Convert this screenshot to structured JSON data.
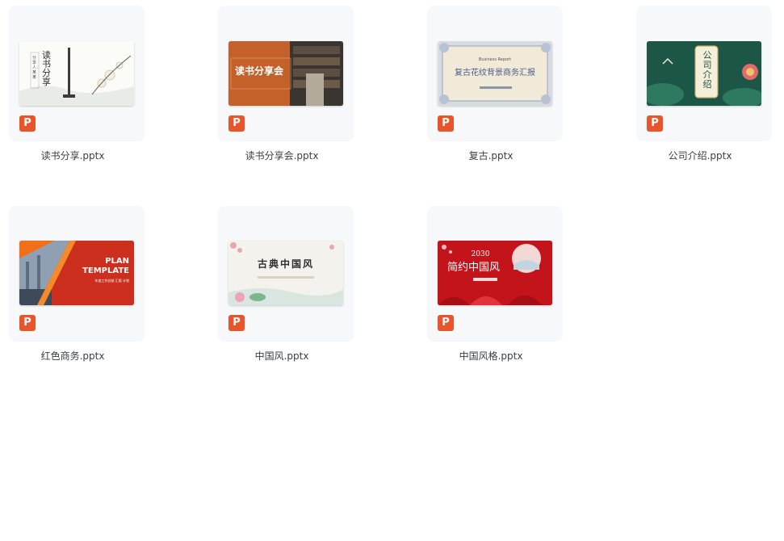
{
  "files": [
    {
      "name": "读书分享.pptx",
      "thumb_text": "读书分享",
      "thumb_small": "分享人：某某"
    },
    {
      "name": "读书分享会.pptx",
      "thumb_text": "读书分享会"
    },
    {
      "name": "复古.pptx",
      "thumb_text": "复古花纹背景商务汇报",
      "thumb_small": "Business Report"
    },
    {
      "name": "公司介绍.pptx",
      "thumb_text": "公司介绍"
    },
    {
      "name": "红色商务.pptx",
      "thumb_text": "PLAN",
      "thumb_text2": "TEMPLATE",
      "thumb_small": "年度工作总结 汇报 计划"
    },
    {
      "name": "中国风.pptx",
      "thumb_text": "古典中国风"
    },
    {
      "name": "中国风格.pptx",
      "thumb_text": "简约中国风",
      "thumb_year": "2030"
    }
  ],
  "badge_letter": "P",
  "colors": {
    "badge": "#e8542b",
    "tile_bg": "#f7f8fa",
    "text": "#3a3d42"
  }
}
